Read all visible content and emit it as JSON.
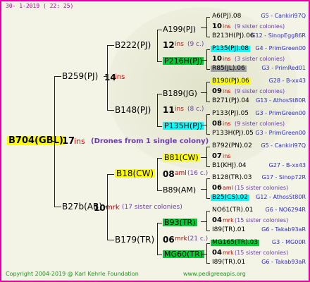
{
  "header": {
    "date_line": "30-   1-2019 (  22:  25)"
  },
  "footer": {
    "copyright": "Copyright 2004-2019 @ Karl Kehrle Foundation",
    "url": "www.pedigreeapis.org"
  },
  "colors": {
    "yellow": "#ffff00",
    "cyan": "#00ffff",
    "green": "#00cc33",
    "gray": "#a0a0a0",
    "ins": "#e00000",
    "mrk": "#c00000",
    "colony": "#6a3ab0",
    "note": "#2a2acc"
  },
  "root": {
    "name": "B704(GBL)",
    "count": "17",
    "unit": "ins",
    "note": "(Drones from 1 single colony)"
  },
  "g1": [
    {
      "name": "B259(PJ)",
      "count": "14",
      "unit": "ins"
    },
    {
      "name": "B27b(AB)",
      "count": "10",
      "unit": "mrk",
      "note": "(17 sister colonies)"
    }
  ],
  "g2": [
    {
      "name": "B222(PJ)",
      "count": "12",
      "unit": "ins",
      "note": "(9 c.)"
    },
    {
      "name": "B148(PJ)",
      "count": "11",
      "unit": "ins",
      "note": "(8 c.)"
    },
    {
      "name": "B18(CW)",
      "count": "08",
      "unit": "aml",
      "note": "(16 c.)"
    },
    {
      "name": "B179(TR)",
      "count": "06",
      "unit": "mrk",
      "note": "(21 c.)"
    }
  ],
  "g3": [
    {
      "name": "A199(PJ)"
    },
    {
      "name": "P216H(PJ)"
    },
    {
      "name": "B189(JG)"
    },
    {
      "name": "P135H(PJ)"
    },
    {
      "name": "B81(CW)"
    },
    {
      "name": "B89(AM)"
    },
    {
      "name": "B93(TR)"
    },
    {
      "name": "MG60(TR)"
    }
  ],
  "rows": [
    {
      "name": "A6(PJ).08",
      "code": "G5 - Cankiri97Q"
    },
    {
      "count": "10",
      "unit": "ins",
      "note": "(9 sister colonies)"
    },
    {
      "name": "B213H(PJ).06",
      "code": "G12 - SinopEgg86R"
    },
    {
      "name": "P135(PJ).08",
      "code": "G4 - PrimGreen00"
    },
    {
      "count": "10",
      "unit": "ins",
      "note": "(3 sister colonies)"
    },
    {
      "name": "R85(JL).06",
      "code": "G3 - PrimRed01"
    },
    {
      "name": "B190(PJ).06",
      "code": "G28 - B-xx43"
    },
    {
      "count": "09",
      "unit": "ins",
      "note": "(9 sister colonies)"
    },
    {
      "name": "B271(PJ).04",
      "code": "G13 - AthosSt80R"
    },
    {
      "name": "P133(PJ).05",
      "code": "G3 - PrimGreen00"
    },
    {
      "count": "08",
      "unit": "ins",
      "note": "(9 sister colonies)"
    },
    {
      "name": "P133H(PJ).05",
      "code": "G3 - PrimGreen00"
    },
    {
      "name": "B792(PN).02",
      "code": "G5 - Cankiri97Q"
    },
    {
      "count": "07",
      "unit": "ins",
      "note": ""
    },
    {
      "name": "B1(KHJ).04",
      "code": "G27 - B-xx43"
    },
    {
      "name": "B128(TR).03",
      "code": "G17 - Sinop72R"
    },
    {
      "count": "06",
      "unit": "aml",
      "note": "(15 sister colonies)"
    },
    {
      "name": "B25(CS).02",
      "code": "G12 - AthosSt80R"
    },
    {
      "name": "NO61(TR).01",
      "code": "G6 - NO6294R"
    },
    {
      "count": "04",
      "unit": "mrk",
      "note": "(15 sister colonies)"
    },
    {
      "name": "I89(TR).01",
      "code": "G6 - Takab93aR"
    },
    {
      "name": "MG165(TR).03",
      "code": "G3 - MG00R"
    },
    {
      "count": "04",
      "unit": "mrk",
      "note": "(15 sister colonies)"
    },
    {
      "name": "I89(TR).01",
      "code": "G6 - Takab93aR"
    }
  ]
}
